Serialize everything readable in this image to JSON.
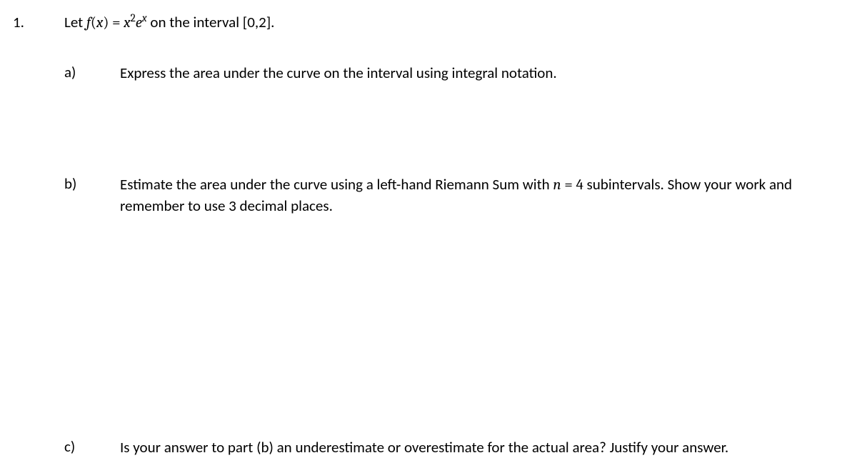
{
  "problem": {
    "number": "1.",
    "stem_prefix": "Let ",
    "stem_lhs": "f",
    "stem_lparen": "(",
    "stem_var1": "x",
    "stem_rparen": ")",
    "stem_eq": " = ",
    "stem_var2": "x",
    "stem_sup1": "2",
    "stem_e": "e",
    "stem_sup2": "x",
    "stem_suffix": " on the interval [0,2].",
    "parts": {
      "a": {
        "label": "a)",
        "text": "Express the area under the curve on the interval using integral notation."
      },
      "b": {
        "label": "b)",
        "text_prefix": "Estimate the area under the curve using a left-hand Riemann Sum with ",
        "text_n": "n",
        "text_eq": " = 4",
        "text_suffix": " subintervals. Show your work and remember to use 3 decimal places."
      },
      "c": {
        "label": "c)",
        "text": "Is your answer to part (b) an underestimate or overestimate for the actual area?  Justify your answer."
      }
    }
  }
}
